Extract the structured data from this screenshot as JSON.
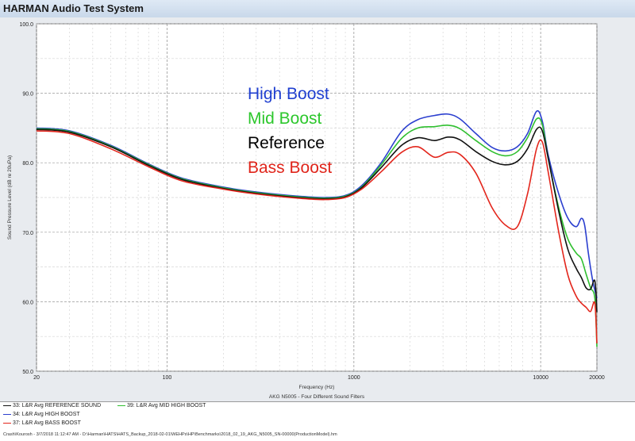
{
  "window": {
    "title": "HARMAN Audio Test System"
  },
  "chart_data": {
    "type": "line",
    "xscale": "log",
    "xlim": [
      20,
      20000
    ],
    "ylim": [
      50,
      100
    ],
    "xlabel": "Frequency (Hz)",
    "ylabel": "Sound Pressure Level (dB re 20uPa)",
    "x_ticks": [
      "20",
      "100",
      "1000",
      "10000",
      "20000"
    ],
    "y_ticks": [
      "100.0",
      "90.0",
      "80.0",
      "70.0",
      "60.0",
      "50.0"
    ],
    "grid": true,
    "caption": "AKG N5005 - Four Different Sound Filters",
    "annotations": [
      {
        "text": "High Boost",
        "color": "#1f3fd0"
      },
      {
        "text": "Mid Boost",
        "color": "#2cc72c"
      },
      {
        "text": "Reference",
        "color": "#000000"
      },
      {
        "text": "Bass Boost",
        "color": "#e0251b"
      }
    ],
    "series": [
      {
        "name": "34: L&R Avg HIGH BOOST",
        "color": "#2b3fcf",
        "points": [
          [
            20,
            85.0
          ],
          [
            30,
            84.6
          ],
          [
            50,
            82.5
          ],
          [
            80,
            79.8
          ],
          [
            120,
            77.8
          ],
          [
            200,
            76.5
          ],
          [
            300,
            75.8
          ],
          [
            500,
            75.2
          ],
          [
            700,
            75.0
          ],
          [
            900,
            75.3
          ],
          [
            1100,
            76.7
          ],
          [
            1400,
            80.0
          ],
          [
            1800,
            84.5
          ],
          [
            2200,
            86.2
          ],
          [
            2700,
            86.8
          ],
          [
            3200,
            87.0
          ],
          [
            3700,
            86.3
          ],
          [
            4500,
            84.2
          ],
          [
            5500,
            82.2
          ],
          [
            6500,
            81.7
          ],
          [
            7500,
            82.3
          ],
          [
            8500,
            84.2
          ],
          [
            9500,
            87.4
          ],
          [
            10200,
            86.0
          ],
          [
            11000,
            81.0
          ],
          [
            12500,
            75.5
          ],
          [
            14000,
            72.0
          ],
          [
            15500,
            70.8
          ],
          [
            16500,
            72.0
          ],
          [
            17200,
            71.0
          ],
          [
            18000,
            67.0
          ],
          [
            19000,
            63.0
          ],
          [
            20000,
            60.5
          ]
        ]
      },
      {
        "name": "39: L&R Avg MID HIGH BOOST",
        "color": "#2fbf2f",
        "points": [
          [
            20,
            84.9
          ],
          [
            30,
            84.5
          ],
          [
            50,
            82.4
          ],
          [
            80,
            79.7
          ],
          [
            120,
            77.7
          ],
          [
            200,
            76.4
          ],
          [
            300,
            75.7
          ],
          [
            500,
            75.1
          ],
          [
            700,
            74.9
          ],
          [
            900,
            75.2
          ],
          [
            1100,
            76.5
          ],
          [
            1400,
            79.7
          ],
          [
            1800,
            83.5
          ],
          [
            2200,
            85.0
          ],
          [
            2700,
            85.2
          ],
          [
            3200,
            85.4
          ],
          [
            3700,
            84.9
          ],
          [
            4500,
            83.2
          ],
          [
            5500,
            81.6
          ],
          [
            6500,
            81.0
          ],
          [
            7500,
            81.6
          ],
          [
            8500,
            83.6
          ],
          [
            9500,
            86.3
          ],
          [
            10200,
            85.5
          ],
          [
            11000,
            80.5
          ],
          [
            12500,
            73.5
          ],
          [
            14000,
            69.0
          ],
          [
            15500,
            67.0
          ],
          [
            16500,
            66.2
          ],
          [
            17500,
            64.0
          ],
          [
            18500,
            62.0
          ],
          [
            19500,
            60.5
          ],
          [
            20000,
            53.5
          ]
        ]
      },
      {
        "name": "33: L&R Avg REFERENCE SOUND",
        "color": "#111111",
        "points": [
          [
            20,
            84.8
          ],
          [
            30,
            84.4
          ],
          [
            50,
            82.3
          ],
          [
            80,
            79.6
          ],
          [
            120,
            77.6
          ],
          [
            200,
            76.3
          ],
          [
            300,
            75.6
          ],
          [
            500,
            75.0
          ],
          [
            700,
            74.8
          ],
          [
            900,
            75.1
          ],
          [
            1100,
            76.4
          ],
          [
            1400,
            79.3
          ],
          [
            1800,
            82.5
          ],
          [
            2200,
            83.6
          ],
          [
            2700,
            83.2
          ],
          [
            3200,
            83.7
          ],
          [
            3700,
            83.3
          ],
          [
            4500,
            81.6
          ],
          [
            5500,
            80.2
          ],
          [
            6500,
            79.7
          ],
          [
            7500,
            80.2
          ],
          [
            8500,
            82.0
          ],
          [
            9500,
            84.8
          ],
          [
            10200,
            84.6
          ],
          [
            11000,
            80.5
          ],
          [
            12500,
            73.0
          ],
          [
            14000,
            67.5
          ],
          [
            15500,
            64.8
          ],
          [
            16500,
            63.5
          ],
          [
            17500,
            62.0
          ],
          [
            18500,
            61.8
          ],
          [
            19500,
            63.0
          ],
          [
            20000,
            58.5
          ]
        ]
      },
      {
        "name": "37: L&R Avg BASS BOOST",
        "color": "#e3261c",
        "points": [
          [
            20,
            84.6
          ],
          [
            30,
            84.2
          ],
          [
            50,
            82.0
          ],
          [
            80,
            79.4
          ],
          [
            120,
            77.4
          ],
          [
            200,
            76.2
          ],
          [
            300,
            75.5
          ],
          [
            500,
            74.9
          ],
          [
            700,
            74.7
          ],
          [
            900,
            75.0
          ],
          [
            1100,
            76.2
          ],
          [
            1400,
            78.7
          ],
          [
            1800,
            81.5
          ],
          [
            2200,
            82.3
          ],
          [
            2700,
            80.8
          ],
          [
            3200,
            81.5
          ],
          [
            3700,
            81.2
          ],
          [
            4500,
            78.5
          ],
          [
            5500,
            73.5
          ],
          [
            6500,
            71.0
          ],
          [
            7500,
            70.8
          ],
          [
            8500,
            75.5
          ],
          [
            9500,
            82.0
          ],
          [
            10200,
            83.0
          ],
          [
            11000,
            78.5
          ],
          [
            12500,
            70.0
          ],
          [
            14000,
            63.8
          ],
          [
            15500,
            60.8
          ],
          [
            16500,
            59.8
          ],
          [
            17500,
            59.2
          ],
          [
            18500,
            58.6
          ],
          [
            19500,
            59.8
          ],
          [
            20000,
            54.0
          ]
        ]
      }
    ],
    "legend": [
      {
        "label": "33: L&R Avg REFERENCE SOUND",
        "color": "#111111"
      },
      {
        "label": "39: L&R Avg MID HIGH BOOST",
        "color": "#2fbf2f"
      },
      {
        "label": "34: L&R Avg HIGH BOOST",
        "color": "#2b3fcf"
      },
      {
        "label": "37: L&R Avg BASS BOOST",
        "color": "#e3261c"
      }
    ],
    "legend_placement": "bottom-left"
  },
  "footer": {
    "path": "Crash\\Kourosh - 3/7/2018 11:12:47 AM - D:\\Harman\\HATS\\HATS_Backup_2018-02-01\\WEHPs\\HP\\Benchmarks\\2018_02_19_AKG_N5005_SN-00000(ProductionModel).hm"
  }
}
